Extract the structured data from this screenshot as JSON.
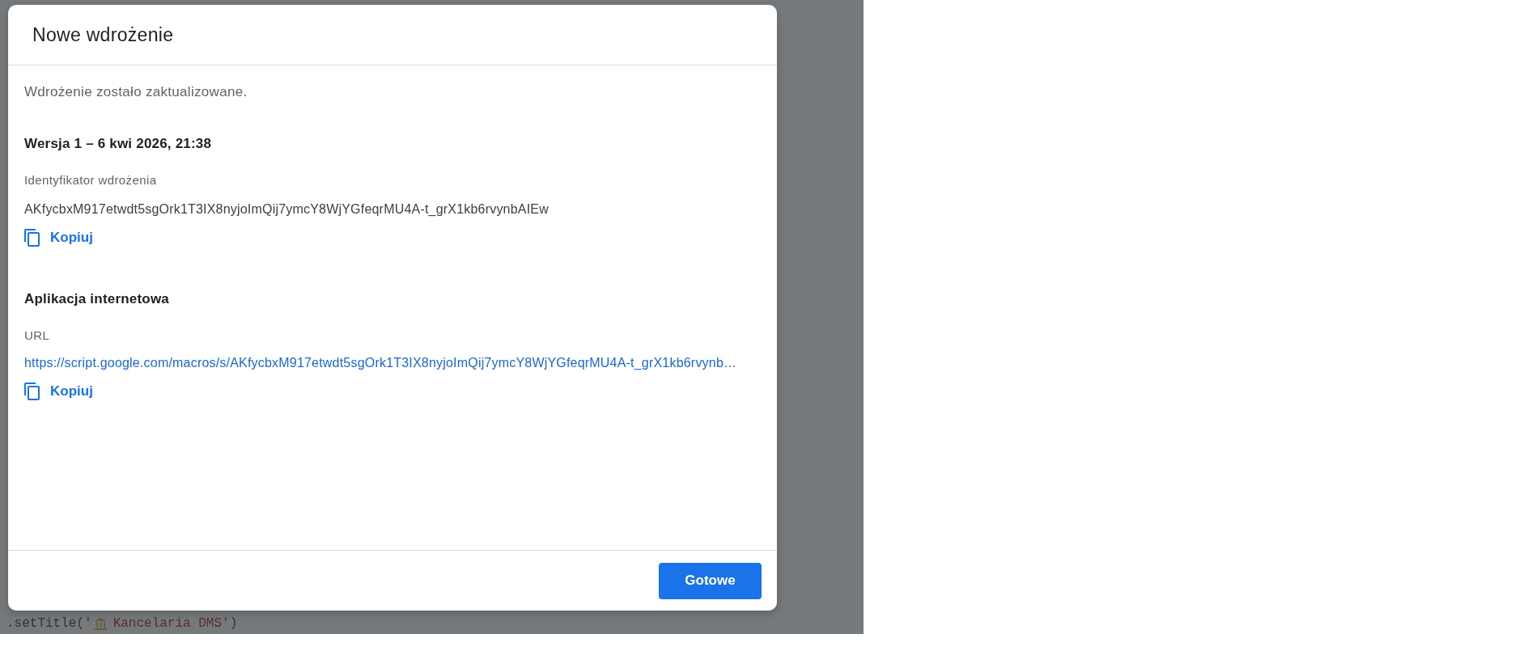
{
  "dialog": {
    "title": "Nowe wdrożenie",
    "message": "Wdrożenie zostało zaktualizowane.",
    "sections": [
      {
        "kind": "text",
        "heading": "Wersja 1 – 6 kwi 2026, 21:38",
        "label": "Identyfikator wdrożenia",
        "value": "AKfycbxM917etwdt5sgOrk1T3IX8nyjoImQij7ymcY8WjYGfeqrMU4A-t_grX1kb6rvynbAIEw",
        "copy_label": "Kopiuj"
      },
      {
        "kind": "link",
        "heading": "Aplikacja internetowa",
        "label": "URL",
        "value": "https://script.google.com/macros/s/AKfycbxM917etwdt5sgOrk1T3IX8nyjoImQij7ymcY8WjYGfeqrMU4A-t_grX1kb6rvynb…",
        "copy_label": "Kopiuj"
      }
    ],
    "primary_button": "Gotowe"
  },
  "background_code": {
    "call": ".setTitle('",
    "title": "Kancelaria DMS'",
    "close": ")"
  }
}
